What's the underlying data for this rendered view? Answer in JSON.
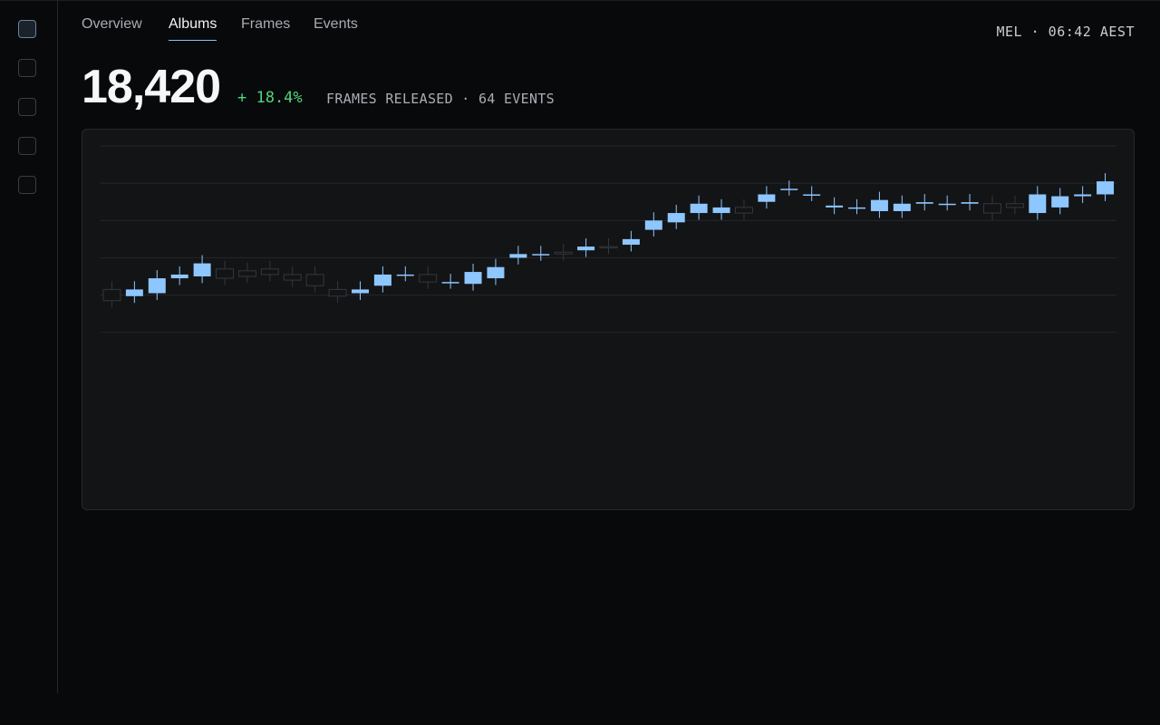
{
  "header": {
    "tabs": [
      {
        "label": "Overview",
        "active": false
      },
      {
        "label": "Albums",
        "active": true
      },
      {
        "label": "Frames",
        "active": false
      },
      {
        "label": "Events",
        "active": false
      }
    ],
    "clock": "MEL · 06:42 AEST"
  },
  "summary": {
    "value": "18,420",
    "delta": "+ 18.4%",
    "caption": "FRAMES RELEASED · 64 EVENTS"
  },
  "colors": {
    "up": "#8ec6ff",
    "down_outline": "#34373c",
    "grid": "#25272b",
    "accent": "#8fbfef",
    "positive": "#4fd57a"
  },
  "chart_data": {
    "type": "candlestick",
    "grid": true,
    "ylim": [
      0,
      7
    ],
    "x": [
      1,
      2,
      3,
      4,
      5,
      6,
      7,
      8,
      9,
      10,
      11,
      12,
      13,
      14,
      15,
      16,
      17,
      18,
      19,
      20,
      21,
      22,
      23,
      24,
      25,
      26,
      27,
      28,
      29,
      30,
      31,
      32,
      33,
      34,
      35,
      36,
      37,
      38,
      39,
      40,
      41,
      42,
      43,
      44,
      45
    ],
    "open": [
      3.15,
      2.97,
      3.05,
      3.45,
      3.5,
      3.7,
      3.65,
      3.7,
      3.55,
      3.55,
      3.15,
      3.05,
      3.25,
      3.55,
      3.55,
      3.35,
      3.3,
      3.45,
      4.0,
      4.1,
      4.15,
      4.2,
      4.3,
      4.35,
      4.75,
      4.95,
      5.2,
      5.2,
      5.35,
      5.5,
      5.85,
      5.7,
      5.35,
      5.35,
      5.25,
      5.25,
      5.45,
      5.45,
      5.45,
      5.45,
      5.45,
      5.2,
      5.35,
      5.65,
      5.7
    ],
    "close": [
      2.85,
      3.15,
      3.45,
      3.55,
      3.85,
      3.45,
      3.5,
      3.55,
      3.4,
      3.25,
      2.97,
      3.15,
      3.55,
      3.55,
      3.35,
      3.35,
      3.62,
      3.75,
      4.1,
      4.1,
      4.1,
      4.3,
      4.28,
      4.5,
      5.0,
      5.2,
      5.45,
      5.35,
      5.2,
      5.7,
      5.85,
      5.7,
      5.4,
      5.35,
      5.55,
      5.45,
      5.49,
      5.45,
      5.49,
      5.2,
      5.35,
      5.7,
      5.65,
      5.7,
      6.05
    ]
  }
}
